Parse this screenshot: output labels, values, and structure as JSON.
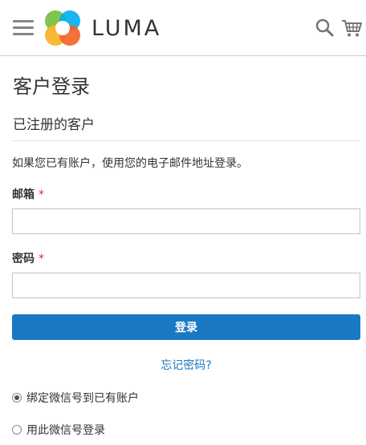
{
  "header": {
    "brand": "LUMA",
    "colors": {
      "logo_orange": "#f26322",
      "logo_yellow": "#f7b52c",
      "logo_green": "#7ac143",
      "logo_blue": "#00aeef",
      "logo_teal": "#00a79d"
    },
    "icons": {
      "menu": "hamburger-menu-icon",
      "search": "search-icon",
      "cart": "shopping-cart-icon"
    }
  },
  "main": {
    "page_title": "客户登录",
    "block_title": "已注册的客户",
    "intro": "如果您已有账户，使用您的电子邮件地址登录。",
    "email": {
      "label": "邮箱",
      "required_mark": "*",
      "value": "",
      "placeholder": ""
    },
    "password": {
      "label": "密码",
      "required_mark": "*",
      "value": "",
      "placeholder": ""
    },
    "login_button": "登录",
    "forgot_link": "忘记密码?",
    "options": [
      {
        "label": "绑定微信号到已有账户",
        "checked": true
      },
      {
        "label": "用此微信号登录",
        "checked": false
      }
    ]
  },
  "colors": {
    "primary": "#1979c3",
    "required": "#e02b27",
    "text": "#333333"
  }
}
